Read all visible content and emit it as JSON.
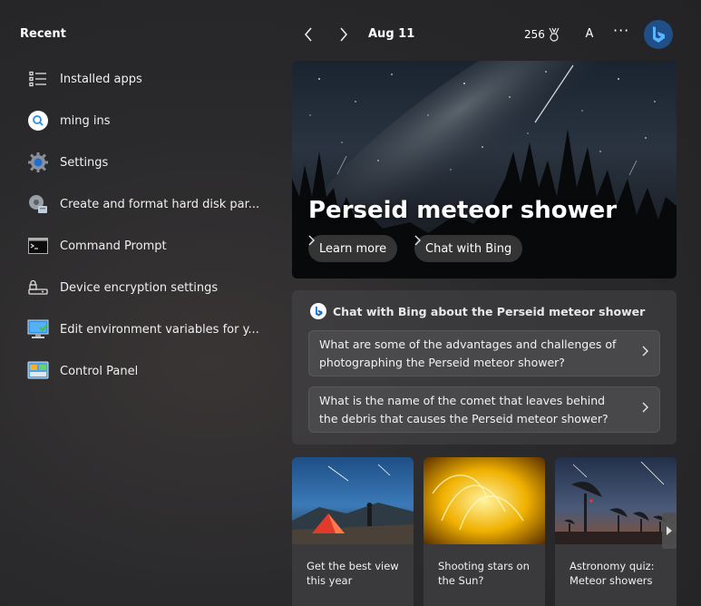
{
  "recent": {
    "title": "Recent",
    "items": [
      {
        "label": "Installed apps",
        "icon": "list-icon"
      },
      {
        "label": "ming ins",
        "icon": "search-icon"
      },
      {
        "label": "Settings",
        "icon": "gear-icon"
      },
      {
        "label": "Create and format hard disk par...",
        "icon": "disk-management-icon"
      },
      {
        "label": "Command Prompt",
        "icon": "terminal-icon"
      },
      {
        "label": "Device encryption settings",
        "icon": "device-encryption-icon"
      },
      {
        "label": "Edit environment variables for y...",
        "icon": "system-properties-icon"
      },
      {
        "label": "Control Panel",
        "icon": "control-panel-icon"
      }
    ]
  },
  "topbar": {
    "date": "Aug 11",
    "points": "256",
    "avatar_initial": "A",
    "more": "···"
  },
  "hero": {
    "title": "Perseid meteor shower",
    "learn_more": "Learn more",
    "chat_with_bing": "Chat with Bing"
  },
  "chat": {
    "heading": "Chat with Bing about the Perseid meteor shower",
    "questions": [
      "What are some of the advantages and challenges of photographing the Perseid meteor shower?",
      "What is the name of the comet that leaves behind the debris that causes the Perseid meteor shower?"
    ]
  },
  "cards": [
    {
      "caption": "Get the best view this year"
    },
    {
      "caption": "Shooting stars on the Sun?"
    },
    {
      "caption": "Astronomy quiz: Meteor showers"
    }
  ],
  "colors": {
    "bing_blue": "#2a8fe8",
    "background": "#2a2a2c"
  }
}
